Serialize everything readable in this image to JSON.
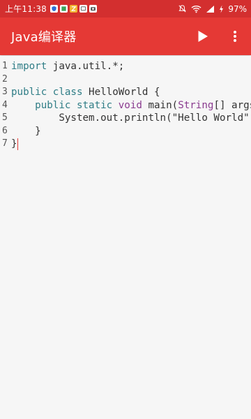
{
  "status_bar": {
    "time": "上午11:38",
    "battery": "97%",
    "notification_icons": [
      "shield-icon",
      "box-icon",
      "z-icon",
      "message-icon",
      "camera-icon"
    ],
    "icons": [
      "muted-bell-icon",
      "wifi-icon",
      "signal-icon",
      "charging-icon"
    ]
  },
  "toolbar": {
    "title": "Java编译器",
    "run_icon": "play-icon",
    "menu_icon": "more-vertical-icon"
  },
  "editor": {
    "line_numbers": [
      "1",
      "2",
      "3",
      "4",
      "5",
      "6",
      "7"
    ],
    "lines": [
      [
        {
          "t": "import",
          "c": "kw"
        },
        {
          "t": " java.util.*;",
          "c": ""
        }
      ],
      [],
      [
        {
          "t": "public",
          "c": "kw"
        },
        {
          "t": " ",
          "c": ""
        },
        {
          "t": "class",
          "c": "kw"
        },
        {
          "t": " HelloWorld {",
          "c": ""
        }
      ],
      [
        {
          "t": "    ",
          "c": ""
        },
        {
          "t": "public",
          "c": "kw"
        },
        {
          "t": " ",
          "c": ""
        },
        {
          "t": "static",
          "c": "kw"
        },
        {
          "t": " ",
          "c": ""
        },
        {
          "t": "void",
          "c": "ty"
        },
        {
          "t": " main(",
          "c": ""
        },
        {
          "t": "String",
          "c": "ty"
        },
        {
          "t": "[] args) {",
          "c": ""
        }
      ],
      [
        {
          "t": "        System.out.println(\"Hello World\");",
          "c": ""
        }
      ],
      [
        {
          "t": "    }",
          "c": ""
        }
      ],
      [
        {
          "t": "}",
          "c": ""
        }
      ]
    ]
  },
  "colors": {
    "status_bar": "#d32f2f",
    "toolbar": "#e53935",
    "keyword": "#2f7d86",
    "type": "#8a3b8f",
    "cursor": "#e53935"
  }
}
